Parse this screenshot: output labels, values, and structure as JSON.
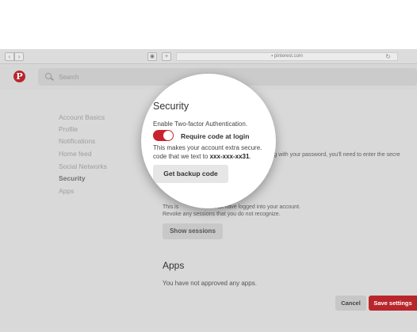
{
  "browser": {
    "back_icon": "‹",
    "forward_icon": "›",
    "url": "pinterest.com",
    "lock_icon": "🔒"
  },
  "header": {
    "logo_letter": "P",
    "search_placeholder": "Search"
  },
  "sidebar": {
    "items": [
      {
        "label": "Account Basics"
      },
      {
        "label": "Profile"
      },
      {
        "label": "Notifications"
      },
      {
        "label": "Home feed"
      },
      {
        "label": "Social Networks"
      },
      {
        "label": "Security",
        "active": true
      },
      {
        "label": "Apps"
      }
    ]
  },
  "security": {
    "title": "Security",
    "two_factor_text": "Enable Two-factor Authentication.",
    "toggle_label": "Require code at login",
    "toggle_on": true,
    "desc_line1": "This makes your account extra secure.",
    "desc_line2_prefix": "code that we text to ",
    "phone": "xxx-xxx-xx31",
    "desc_line2_suffix": ".",
    "behind_text": "long with your password, you'll need to enter the secre",
    "backup_button": "Get backup code"
  },
  "sessions": {
    "line1_start": "This is",
    "line1_end": "that have logged into your account.",
    "line2": "Revoke any sessions that you do not recognize.",
    "button": "Show sessions"
  },
  "apps": {
    "title": "Apps",
    "desc": "You have not approved any apps."
  },
  "footer": {
    "cancel": "Cancel",
    "save": "Save settings"
  },
  "colors": {
    "brand": "#b8262c"
  }
}
